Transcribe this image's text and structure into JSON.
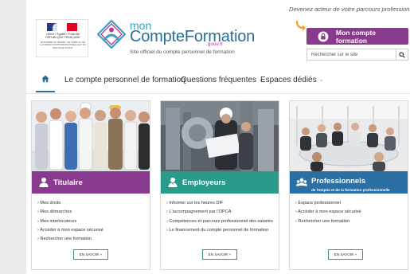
{
  "header": {
    "gov_logo_lines": [
      "Liberté • Égalité • Fraternité",
      "RÉPUBLIQUE FRANÇAISE"
    ],
    "gov_ministry": "MINISTÈRE DU TRAVAIL, DE L'EMPLOI, DE LA FORMATION PROFESSIONNELLE ET DU DIALOGUE SOCIAL",
    "brand_mon": "mon",
    "brand_name": "CompteFormation",
    "brand_gouv": ".gouv.fr",
    "tagline": "Site officiel du compte personnel de formation",
    "promo": "Devenez acteur de votre parcours professionnel",
    "account_button": "Mon compte formation",
    "search_placeholder": "Rechercher sur le site"
  },
  "nav": {
    "items": [
      "Le compte personnel de formation",
      "Questions fréquentes",
      "Espaces dédiés"
    ],
    "active": "home"
  },
  "colors": {
    "accent_purple": "#8a3a8e",
    "accent_teal": "#2a9a8b",
    "accent_blue": "#2c6fa3",
    "brand_blue": "#2b6f98"
  },
  "cards": [
    {
      "title": "Titulaire",
      "subtitle": "",
      "icon": "person-icon",
      "links": [
        "Mes droits",
        "Mes démarches",
        "Mes interlocuteurs",
        "Accéder à mon espace sécurisé",
        "Rechercher une formation"
      ],
      "more": "EN SAVOIR +"
    },
    {
      "title": "Employeurs",
      "subtitle": "",
      "icon": "employer-icon",
      "links": [
        "Informer sur les heures DIF",
        "L'accompagnement par l'OPCA",
        "Compétences et parcours professionnel des salariés",
        "Le financement du compte personnel de formation"
      ],
      "more": "EN SAVOIR +"
    },
    {
      "title": "Professionnels",
      "subtitle": "de l'emploi et de la formation professionnelle",
      "icon": "group-icon",
      "links": [
        "Espace professionnel",
        "Accéder à mon espace sécurisé",
        "Rechercher une formation"
      ],
      "more": "EN SAVOIR +"
    }
  ]
}
